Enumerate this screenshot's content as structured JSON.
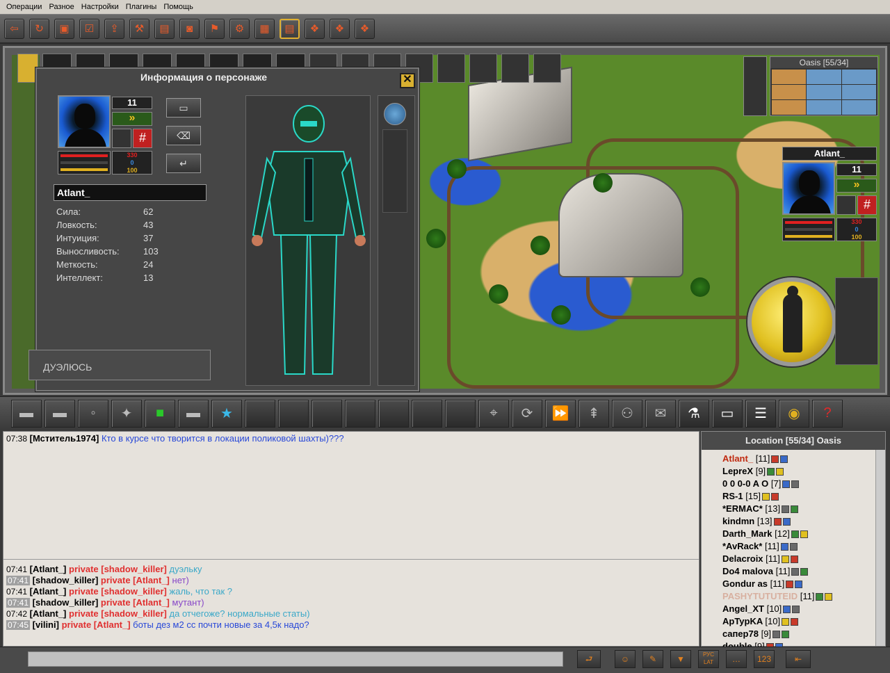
{
  "menubar": {
    "items": [
      "Операции",
      "Разное",
      "Настройки",
      "Плагины",
      "Помощь"
    ]
  },
  "toolbar": {
    "icons": [
      "exit-icon",
      "refresh-icon",
      "chest-icon",
      "checklist-icon",
      "upload-icon",
      "tools-icon",
      "book-icon",
      "bag-icon",
      "flag-icon",
      "wrench-icon",
      "cart-icon",
      "save-icon",
      "boxes-red-icon",
      "boxes-gray-icon",
      "boxes-flag-icon"
    ]
  },
  "info_panel": {
    "title": "Информация о персонаже",
    "level": "11",
    "rank_arrows": "»",
    "hp_values": [
      "330",
      "0",
      "100"
    ],
    "name": "Atlant_",
    "stats": [
      {
        "label": "Сила:",
        "value": "62"
      },
      {
        "label": "Ловкость:",
        "value": "43"
      },
      {
        "label": "Интуиция:",
        "value": "37"
      },
      {
        "label": "Выносливость:",
        "value": "103"
      },
      {
        "label": "Меткость:",
        "value": "24"
      },
      {
        "label": "Интеллект:",
        "value": "13"
      }
    ],
    "dueling_label": "ДУЭЛЮСЬ",
    "close_label": "✕"
  },
  "right_card": {
    "name": "Atlant_",
    "level": "11",
    "hp_values": [
      "330",
      "0",
      "100"
    ]
  },
  "minimap": {
    "title": "Oasis [55/34]"
  },
  "chat": {
    "top": [
      {
        "time": "07:38",
        "nick": "[Мститель1974]",
        "msg": "Кто в курсе что творится в локации поликовой шахты)???"
      }
    ],
    "private": [
      {
        "time": "07:41",
        "gray": false,
        "from": "[Atlant_]",
        "to": "private [shadow_killer]",
        "msg": "дуэльку"
      },
      {
        "time": "07:41",
        "gray": true,
        "from": "[shadow_killer]",
        "to": "private [Atlant_]",
        "msg": "нет)"
      },
      {
        "time": "07:41",
        "gray": false,
        "from": "[Atlant_]",
        "to": "private [shadow_killer]",
        "msg": "жаль, что так ?"
      },
      {
        "time": "07:41",
        "gray": true,
        "from": "[shadow_killer]",
        "to": "private [Atlant_]",
        "msg": "мутант)"
      },
      {
        "time": "07:42",
        "gray": false,
        "from": "[Atlant_]",
        "to": "private [shadow_killer]",
        "msg": "да отчегоже? нормальные статы)"
      },
      {
        "time": "07:45",
        "gray": true,
        "from": "[vilini]",
        "to": "private [Atlant_]",
        "msg": "боты дез м2 сс почти новые за 4,5к надо?"
      }
    ]
  },
  "players": {
    "header": "Location [55/34] Oasis",
    "list": [
      {
        "name": "Atlant_",
        "level": "[11]",
        "color": "#c02a10"
      },
      {
        "name": "LepreX",
        "level": "[9]",
        "color": "#000000"
      },
      {
        "name": "0 0 0-0 A O",
        "level": "[7]",
        "color": "#000000"
      },
      {
        "name": "RS-1",
        "level": "[15]",
        "color": "#000000"
      },
      {
        "name": "*ERMAC*",
        "level": "[13]",
        "color": "#000000"
      },
      {
        "name": "kindmn",
        "level": "[13]",
        "color": "#000000"
      },
      {
        "name": "Darth_Mark",
        "level": "[12]",
        "color": "#000000"
      },
      {
        "name": "*AvRack*",
        "level": "[11]",
        "color": "#000000"
      },
      {
        "name": "Delacroix",
        "level": "[11]",
        "color": "#000000"
      },
      {
        "name": "Do4 malova",
        "level": "[11]",
        "color": "#000000"
      },
      {
        "name": "Gondur as",
        "level": "[11]",
        "color": "#000000"
      },
      {
        "name": "PASHYTUTUTEID",
        "level": "[11]",
        "color": "#d8b0a0"
      },
      {
        "name": "Angel_XT",
        "level": "[10]",
        "color": "#000000"
      },
      {
        "name": "ApTypKA",
        "level": "[10]",
        "color": "#000000"
      },
      {
        "name": "caпep78",
        "level": "[9]",
        "color": "#000000"
      },
      {
        "name": "double",
        "level": "[9]",
        "color": "#000000"
      }
    ]
  },
  "input_bar": {
    "buttons": [
      "⮐",
      "☺",
      "✎",
      "▼",
      "РУС LAT",
      "…",
      "123",
      "⇤"
    ]
  }
}
